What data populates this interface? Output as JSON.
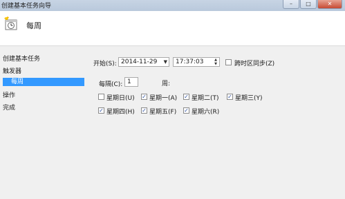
{
  "window": {
    "title": "创建基本任务向导",
    "minimize": "–",
    "maximize": "□",
    "close": "✕"
  },
  "header": {
    "icon": "calendar-clock-icon",
    "title": "每周"
  },
  "sidebar": {
    "items": [
      {
        "label": "创建基本任务"
      },
      {
        "label": "触发器"
      },
      {
        "label": "每周"
      },
      {
        "label": "操作"
      },
      {
        "label": "完成"
      }
    ]
  },
  "form": {
    "start_label": "开始(S):",
    "start_date": "2014-11-29",
    "start_time": "17:37:03",
    "sync_timezone_label": "跨时区同步(Z)",
    "sync_timezone_checked": false,
    "recur_label": "每隔(C):",
    "recur_value": "1",
    "recur_unit": "周:",
    "days": [
      {
        "label": "星期日(U)",
        "checked": false
      },
      {
        "label": "星期一(A)",
        "checked": true
      },
      {
        "label": "星期二(T)",
        "checked": true
      },
      {
        "label": "星期三(Y)",
        "checked": true
      },
      {
        "label": "星期四(H)",
        "checked": true
      },
      {
        "label": "星期五(F)",
        "checked": true
      },
      {
        "label": "星期六(R)",
        "checked": true
      }
    ]
  }
}
